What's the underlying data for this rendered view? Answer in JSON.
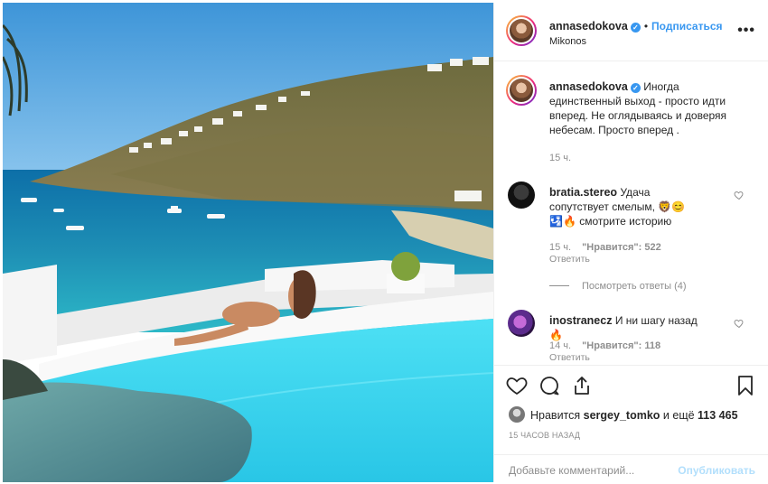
{
  "post": {
    "username": "annasedokova",
    "verified_mark": "✓",
    "follow_label": "Подписаться",
    "separator": "•",
    "location": "Mikonos",
    "more_icon": "…",
    "more_label": "•••"
  },
  "caption": {
    "username": "annasedokova",
    "text": "Иногда единственный выход - просто идти вперед. Не оглядываясь и доверяя небесам. Просто вперед .",
    "time": "15 ч."
  },
  "comments": [
    {
      "username": "bratia.stereo",
      "text": "Удача сопутствует смелым, 🦁😊🛂🔥 смотрите историю",
      "time": "15 ч.",
      "likes": "\"Нравится\": 522",
      "reply_label": "Ответить",
      "view_replies": "Посмотреть ответы (4)"
    },
    {
      "username": "inostranecz",
      "text": "И ни шагу назад🔥",
      "time": "14 ч.",
      "likes": "\"Нравится\": 118",
      "reply_label": "Ответить"
    }
  ],
  "actions": {
    "icons": [
      "heart-icon",
      "comment-icon",
      "share-icon",
      "bookmark-icon"
    ]
  },
  "likes": {
    "prefix": "Нравится",
    "user": "sergey_tomko",
    "middle": "и ещё",
    "count": "113 465"
  },
  "timestamp": "15 ЧАСОВ НАЗАД",
  "add_comment": {
    "placeholder": "Добавьте комментарий...",
    "publish_label": "Опубликовать"
  },
  "colors": {
    "link_blue": "#3897f0",
    "publish_disabled": "#b2dffc",
    "muted": "#8e8e8e",
    "pool": "#3fd6ec",
    "sea": "#1e8fb5"
  }
}
